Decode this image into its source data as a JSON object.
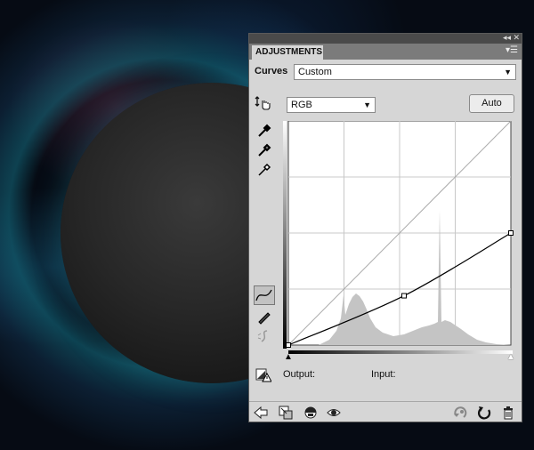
{
  "panel": {
    "tab_label": "ADJUSTMENTS",
    "title_buttons": {
      "collapse": "◂◂",
      "close": "✕"
    },
    "menu_icon": "panel-menu-icon"
  },
  "adjustment": {
    "name_label": "Curves",
    "preset": "Custom"
  },
  "channel": {
    "selected": "RGB"
  },
  "auto_button": "Auto",
  "readouts": {
    "output_label": "Output:",
    "input_label": "Input:"
  },
  "tools": [
    "target-adjust-icon",
    "black-eyedropper-icon",
    "gray-eyedropper-icon",
    "white-eyedropper-icon",
    "curve-point-icon",
    "pencil-icon",
    "smooth-icon"
  ],
  "footer_icons": [
    "back-icon",
    "clip-layer-icon",
    "view-previous-icon",
    "visibility-eye-icon",
    "view-reset-icon",
    "reset-icon",
    "trash-icon"
  ],
  "curve": {
    "points": [
      [
        0,
        0
      ],
      [
        52,
        22
      ],
      [
        100,
        50
      ]
    ],
    "color": "#000000"
  },
  "colors": {
    "panel_bg": "#d6d6d6",
    "tab_strip": "#7b7b7b",
    "histogram": "#c4c4c4"
  }
}
